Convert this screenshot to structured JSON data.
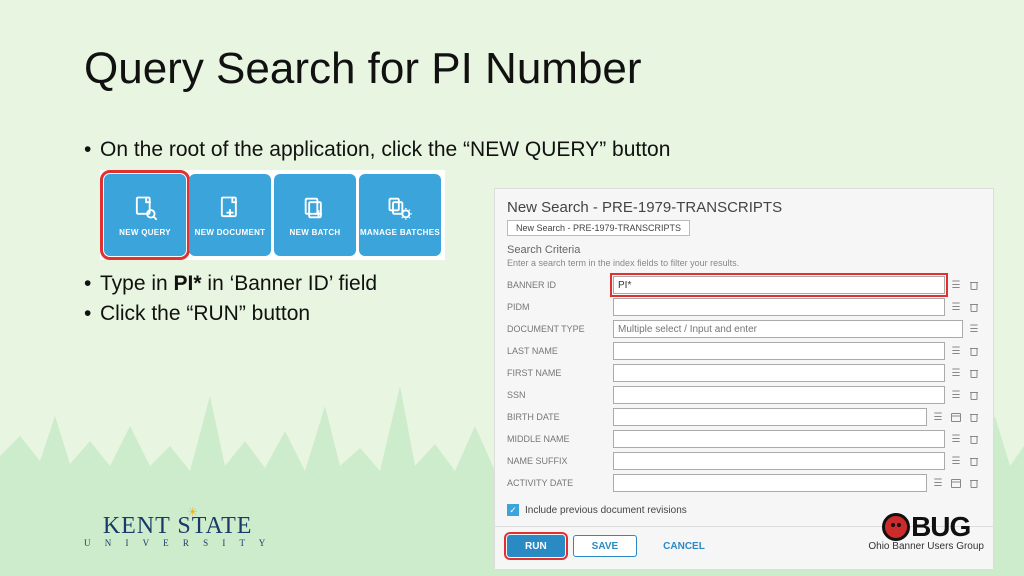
{
  "title": "Query Search for PI Number",
  "bullets": {
    "b1_pre": "On the root of the application, click the “",
    "b1_em": "NEW QUERY",
    "b1_post": "” button",
    "b2_pre": "Type in ",
    "b2_bold": "PI*",
    "b2_post": " in ‘Banner ID’ field",
    "b3": "Click the “RUN” button"
  },
  "tiles": [
    {
      "label": "NEW QUERY"
    },
    {
      "label": "NEW DOCUMENT"
    },
    {
      "label": "NEW BATCH"
    },
    {
      "label": "MANAGE BATCHES"
    }
  ],
  "panel": {
    "title": "New Search - PRE-1979-TRANSCRIPTS",
    "tab": "New Search - PRE-1979-TRANSCRIPTS",
    "criteria_heading": "Search Criteria",
    "criteria_sub": "Enter a search term in the index fields to filter your results.",
    "rows": [
      {
        "label": "BANNER ID",
        "value": "PI*",
        "hl": true,
        "list": true,
        "del": true
      },
      {
        "label": "PIDM",
        "value": "",
        "list": true,
        "del": true
      },
      {
        "label": "DOCUMENT TYPE",
        "value": "",
        "placeholder": "Multiple select / Input and enter",
        "list": true
      },
      {
        "label": "LAST NAME",
        "value": "",
        "list": true,
        "del": true
      },
      {
        "label": "FIRST NAME",
        "value": "",
        "list": true,
        "del": true
      },
      {
        "label": "SSN",
        "value": "",
        "list": true,
        "del": true
      },
      {
        "label": "BIRTH DATE",
        "value": "",
        "list": true,
        "cal": true,
        "del": true
      },
      {
        "label": "MIDDLE NAME",
        "value": "",
        "list": true,
        "del": true
      },
      {
        "label": "NAME SUFFIX",
        "value": "",
        "list": true,
        "del": true
      },
      {
        "label": "ACTIVITY DATE",
        "value": "",
        "list": true,
        "cal": true,
        "del": true
      }
    ],
    "include_label": "Include previous document revisions",
    "buttons": {
      "run": "RUN",
      "save": "SAVE",
      "cancel": "CANCEL"
    }
  },
  "footer": {
    "kent_main": "KENT STATE",
    "kent_sub": "U N I V E R S I T Y",
    "obug_text": "BUG",
    "obug_sub": "Ohio Banner Users Group"
  }
}
